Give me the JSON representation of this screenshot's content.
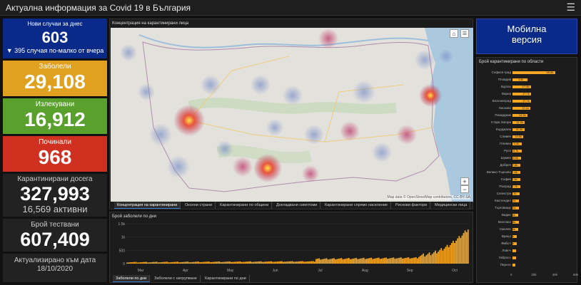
{
  "header": {
    "title": "Актуална информация за Covid 19 в България",
    "menu_icon": "hamburger-icon"
  },
  "cards": {
    "new_cases": {
      "label": "Нови случаи за днес",
      "value": "603",
      "sub": "▼ 395 случая по-малко от вчера",
      "color": "#0a2a8a"
    },
    "infected": {
      "label": "Заболели",
      "value": "29,108",
      "color": "#e0a020"
    },
    "recovered": {
      "label": "Излекувани",
      "value": "16,912",
      "color": "#5aa02c"
    },
    "deaths": {
      "label": "Починали",
      "value": "968",
      "color": "#d03020"
    },
    "quarantined": {
      "label": "Карантинирани досега",
      "value": "327,993",
      "sub": "16,569 активни"
    },
    "tested": {
      "label": "Брой тествани",
      "value": "607,409"
    },
    "updated": {
      "label": "Актуализирано към дата",
      "value": "18/10/2020"
    }
  },
  "map": {
    "title": "Концентрация на карантинирани лица",
    "attribution": "Map data © OpenStreetMap contributors, CC-BY-SA",
    "zoom_in": "+",
    "zoom_out": "−",
    "home_icon": "home-icon",
    "list_icon": "list-icon",
    "tabs": [
      "Концентрация на карантинирани",
      "Околни страни",
      "Карантинирани по общини",
      "Докладвани симптоми",
      "Карантинирани спрямо население",
      "Рискови фактори",
      "Медицински лица"
    ]
  },
  "mobile": {
    "line1": "Мобилна",
    "line2": "версия"
  },
  "bottom_chart": {
    "title": "Брой заболели по дни",
    "tabs": [
      "Заболели по дни",
      "Заболели с натрупване",
      "Карантинирани по дни"
    ],
    "y_ticks": [
      "1.5k",
      "1k",
      "500",
      "0"
    ],
    "x_ticks": [
      "Mar",
      "Apr",
      "May",
      "Jun",
      "Jul",
      "Aug",
      "Sep",
      "Oct"
    ]
  },
  "chart_data": {
    "type": "bar",
    "title": "Брой карантинирани по области",
    "categories": [
      "Софиcя-град",
      "Пловдив",
      "Бургас",
      "Варна",
      "Благоевград",
      "Хасково",
      "Пазарджик",
      "Стара Загора",
      "Кърджали",
      "Сливен",
      "Плевен",
      "Русе",
      "Шумен",
      "Добрич",
      "Велико Търново",
      "София",
      "Разград",
      "Силистра",
      "Кюстендил",
      "Търговище",
      "Видин",
      "Монтана",
      "Смолян",
      "Враца",
      "Ямбол",
      "Ловеч",
      "Габрово",
      "Перник"
    ],
    "values": [
      40.6,
      14,
      17.5,
      17.7,
      17.7,
      17.1,
      14.2,
      11.9,
      11.4,
      10.5,
      9.2,
      8.7,
      8.5,
      7.8,
      7.6,
      7.5,
      7.7,
      6.7,
      6.1,
      6.1,
      5.5,
      5.8,
      5.5,
      4.4,
      4.4,
      3.2,
      3.2,
      2.4
    ],
    "value_labels": [
      "40.6k",
      "14k",
      "17.5k",
      "17.7k",
      "17.7k",
      "17.1k",
      "14.2k",
      "11.9k",
      "11.4k",
      "10.5k",
      "9.2k",
      "8.7k",
      "8.5k",
      "7.8k",
      "7.6k",
      "7.5k",
      "7.7k",
      "6.7k",
      "6.1k",
      "6.1k",
      "5.5k",
      "5.8k",
      "5.5k",
      "4.4k",
      "4.4k",
      "3.2k",
      "3.2k",
      "2.4k"
    ],
    "xlim": [
      0,
      60
    ],
    "x_ticks": [
      "0",
      "20k",
      "40k",
      "60k"
    ]
  }
}
